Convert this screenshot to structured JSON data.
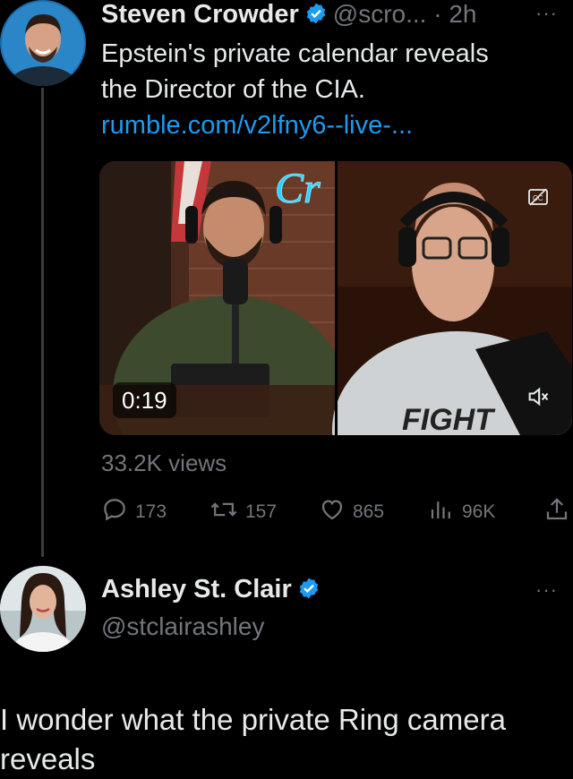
{
  "tweet": {
    "author_name": "Steven Crowder",
    "handle_time": "@scro... · 2h",
    "text_line1": "Epstein's private calendar reveals",
    "text_line2": "the Director of the CIA.",
    "link": "rumble.com/v2lfny6--live-...",
    "video_duration": "0:19",
    "views": "33.2K views",
    "stats": {
      "replies": "173",
      "reposts": "157",
      "likes": "865",
      "view_count": "96K"
    },
    "more": "···"
  },
  "reply": {
    "author_name": "Ashley St. Clair",
    "handle": "@stclairashley",
    "text": "I wonder what the private Ring camera reveals",
    "more": "···"
  },
  "colors": {
    "accent": "#1d9bf0",
    "muted": "#71767b",
    "background": "#000000"
  },
  "icons": [
    "verified-badge-icon",
    "reply-icon",
    "repost-icon",
    "like-icon",
    "views-icon",
    "share-icon",
    "cc-icon",
    "mute-icon"
  ]
}
